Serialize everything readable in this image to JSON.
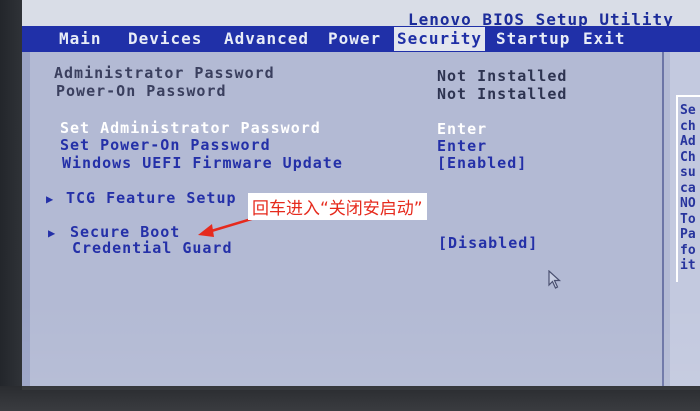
{
  "app_title": "Lenovo BIOS Setup Utility",
  "menu": {
    "tabs": [
      {
        "label": "Main"
      },
      {
        "label": "Devices"
      },
      {
        "label": "Advanced"
      },
      {
        "label": "Power"
      },
      {
        "label": "Security"
      },
      {
        "label": "Startup"
      },
      {
        "label": "Exit"
      }
    ],
    "active": "Security"
  },
  "security": {
    "admin_password_label": "Administrator Password",
    "admin_password_value": "Not Installed",
    "poweron_password_label": "Power-On Password",
    "poweron_password_value": "Not Installed",
    "set_admin_password_label": "Set Administrator Password",
    "set_admin_password_value": "Enter",
    "set_poweron_password_label": "Set Power-On Password",
    "set_poweron_password_value": "Enter",
    "uefi_firmware_update_label": "Windows UEFI Firmware Update",
    "uefi_firmware_update_value": "[Enabled]",
    "tcg_feature_setup_label": "TCG Feature Setup",
    "secure_boot_label": "Secure Boot",
    "credential_guard_label": "Credential Guard",
    "credential_guard_value": "[Disabled]"
  },
  "help_panel_lines": [
    "Se",
    "ch",
    "Ad",
    "Ch",
    "su",
    "ca",
    "NO",
    "To",
    "Pa",
    "fo",
    "it"
  ],
  "annotation_text": "回车进入“关闭安启动”",
  "colors": {
    "screen_bg": "#9aa3c6",
    "menubar": "#2030a8",
    "highlight": "#ffffff",
    "annotation": "#e62a1d"
  },
  "icons": {
    "submenu_marker": "triangle-right",
    "pointer": "mouse-cursor"
  }
}
